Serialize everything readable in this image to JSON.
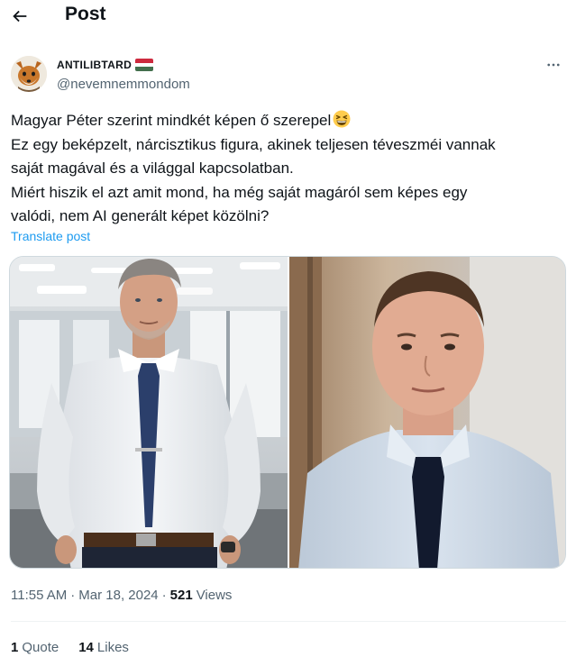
{
  "header": {
    "title": "Post"
  },
  "author": {
    "display_name": "ANTILIBTARD",
    "handle": "@nevemnemmondom"
  },
  "tweet": {
    "lines": [
      "Magyar Péter szerint mindkét képen ő szerepel",
      "Ez egy beképzelt, nárcisztikus figura, akinek teljesen téveszméi vannak",
      "saját magával és a világgal kapcsolatban.",
      "Miért hiszik el azt amit mond, ha még saját magáról sem képes egy",
      "valódi, nem AI generált képet közölni?"
    ],
    "translate_label": "Translate post"
  },
  "meta": {
    "time": "11:55 AM",
    "separator": "·",
    "date": "Mar 18, 2024",
    "separator2": "·",
    "views_count": "521",
    "views_label": "Views"
  },
  "stats": {
    "quotes_count": "1",
    "quotes_label": "Quote",
    "likes_count": "14",
    "likes_label": "Likes"
  },
  "colors": {
    "link": "#1d9bf0",
    "secondary_text": "#536471",
    "primary_text": "#0f1419",
    "border": "#cfd9de",
    "flag_red": "#cd2a3e",
    "flag_white": "#ffffff",
    "flag_green": "#436f4d"
  },
  "icons": {
    "back": "arrow-left-icon",
    "more": "more-horizontal-icon",
    "emoji": "grinning-squinting-face-emoji",
    "flag": "hungary-flag-icon"
  }
}
